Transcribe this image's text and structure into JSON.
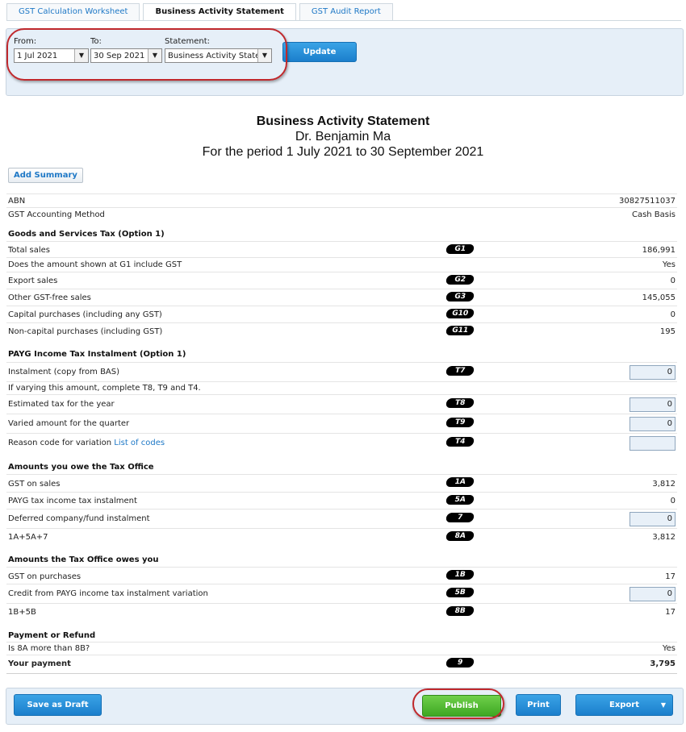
{
  "tabs": [
    "GST Calculation Worksheet",
    "Business Activity Statement",
    "GST Audit Report"
  ],
  "filter": {
    "from_label": "From:",
    "from_value": "1 Jul 2021",
    "to_label": "To:",
    "to_value": "30 Sep 2021",
    "statement_label": "Statement:",
    "statement_value": "Business Activity Stateme",
    "update_label": "Update"
  },
  "report": {
    "title": "Business Activity Statement",
    "name": "Dr. Benjamin Ma",
    "period": "For the period 1 July 2021 to 30 September 2021",
    "add_summary": "Add Summary"
  },
  "info": {
    "abn_label": "ABN",
    "abn_value": "30827511037",
    "method_label": "GST Accounting Method",
    "method_value": "Cash Basis"
  },
  "gst": {
    "heading": "Goods and Services Tax (Option 1)",
    "rows": [
      {
        "label": "Total sales",
        "code": "G1",
        "value": "186,991"
      },
      {
        "label": "Does the amount shown at G1 include GST",
        "code": "",
        "value": "Yes"
      },
      {
        "label": "Export sales",
        "code": "G2",
        "value": "0"
      },
      {
        "label": "Other GST-free sales",
        "code": "G3",
        "value": "145,055"
      },
      {
        "label": "Capital purchases (including any GST)",
        "code": "G10",
        "value": "0"
      },
      {
        "label": "Non-capital purchases (including GST)",
        "code": "G11",
        "value": "195"
      }
    ]
  },
  "payg": {
    "heading": "PAYG Income Tax Instalment (Option 1)",
    "instalment_label": "Instalment (copy from BAS)",
    "instalment_code": "T7",
    "instalment_value": "0",
    "note": "If varying this amount, complete T8, T9 and T4.",
    "estimated_label": "Estimated tax for the year",
    "estimated_code": "T8",
    "estimated_value": "0",
    "varied_label": "Varied amount for the quarter",
    "varied_code": "T9",
    "varied_value": "0",
    "reason_label": "Reason code for variation",
    "reason_link": "List of codes",
    "reason_code": "T4",
    "reason_value": ""
  },
  "owe": {
    "heading": "Amounts you owe the Tax Office",
    "gst_sales_label": "GST on sales",
    "gst_sales_code": "1A",
    "gst_sales_value": "3,812",
    "payg_label": "PAYG tax income tax instalment",
    "payg_code": "5A",
    "payg_value": "0",
    "deferred_label": "Deferred company/fund instalment",
    "deferred_code": "7",
    "deferred_value": "0",
    "sum_label": "1A+5A+7",
    "sum_code": "8A",
    "sum_value": "3,812"
  },
  "owes": {
    "heading": "Amounts the Tax Office owes you",
    "gst_purch_label": "GST on purchases",
    "gst_purch_code": "1B",
    "gst_purch_value": "17",
    "credit_label": "Credit from PAYG income tax instalment variation",
    "credit_code": "5B",
    "credit_value": "0",
    "sum_label": "1B+5B",
    "sum_code": "8B",
    "sum_value": "17"
  },
  "payment": {
    "heading": "Payment or Refund",
    "q_label": "Is 8A more than 8B?",
    "q_value": "Yes",
    "your_label": "Your payment",
    "your_code": "9",
    "your_value": "3,795"
  },
  "footer": {
    "draft": "Save as Draft",
    "publish": "Publish",
    "print": "Print",
    "export": "Export"
  },
  "colors": {
    "accent": "#1e78c6",
    "highlight": "#c0282c",
    "publish": "#4cba2b"
  }
}
